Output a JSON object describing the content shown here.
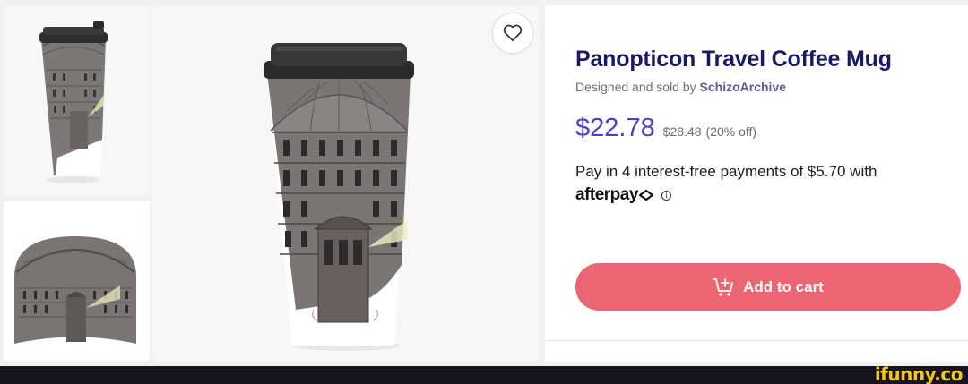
{
  "product": {
    "title": "Panopticon Travel Coffee Mug",
    "byline_prefix": "Designed and sold by ",
    "artist": "SchizoArchive",
    "price": "$22.78",
    "old_price": "$28.48",
    "discount": "(20% off)"
  },
  "afterpay": {
    "text": "Pay in 4 interest-free payments of $5.70 with",
    "logo_text": "afterpay",
    "info_glyph": "i"
  },
  "cart": {
    "label": "Add to cart",
    "icon": "cart-add-icon"
  },
  "favorite": {
    "icon": "heart-icon"
  },
  "watermark": "ifunny.co",
  "colors": {
    "title": "#191966",
    "price": "#4b3ec9",
    "cart_button": "#eb6672",
    "watermark": "#f5c518"
  }
}
